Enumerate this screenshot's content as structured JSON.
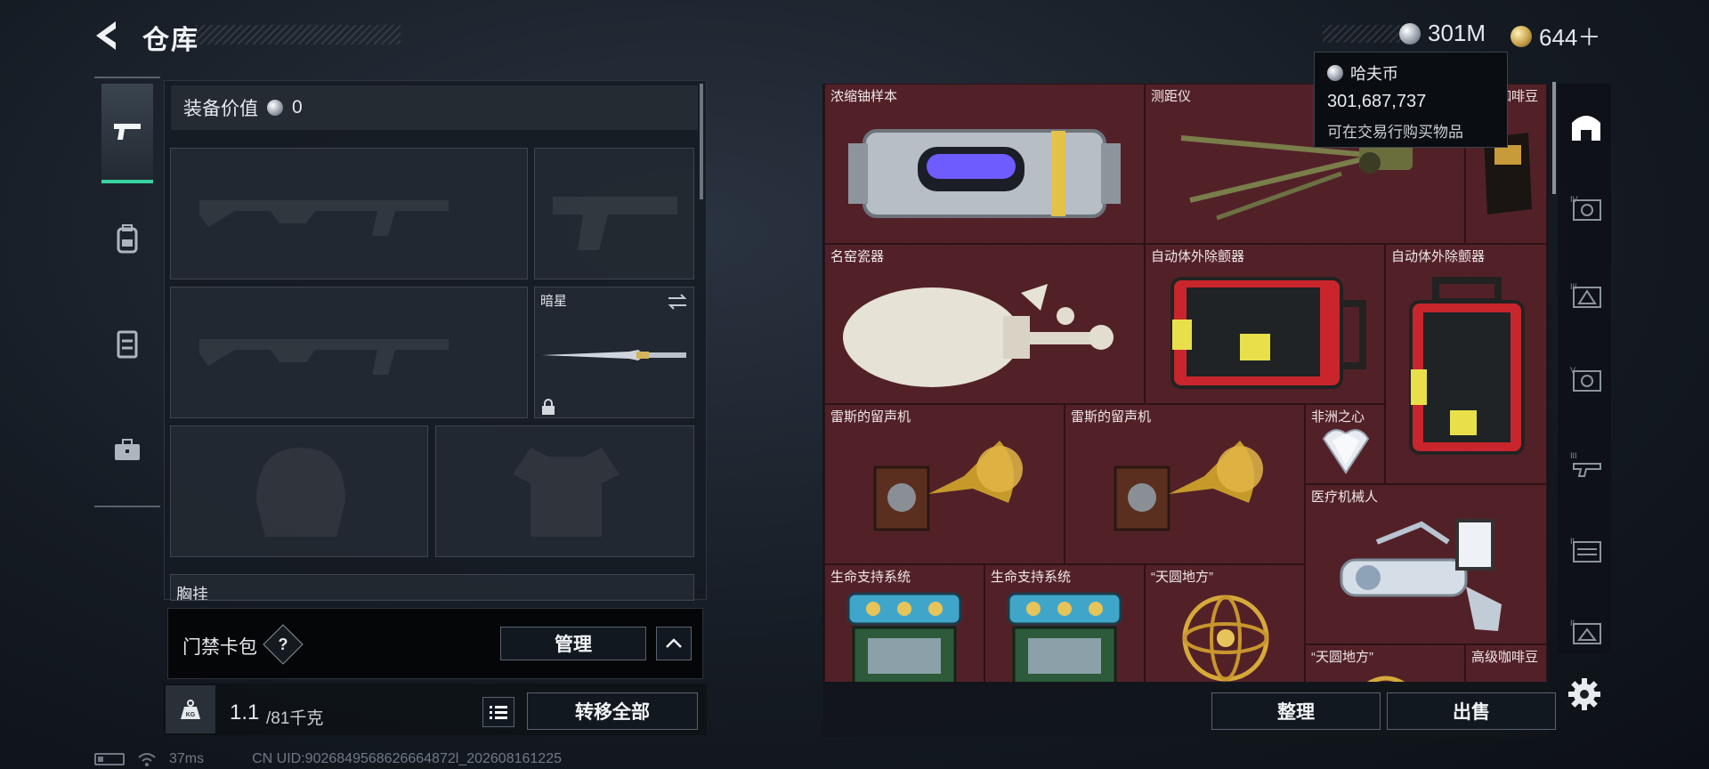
{
  "header": {
    "title": "仓库",
    "currency_haf": "301M",
    "currency_gold": "644＋"
  },
  "tooltip": {
    "name": "哈夫币",
    "amount": "301,687,737",
    "desc": "可在交易行购买物品"
  },
  "loadout": {
    "value_label": "装备价值",
    "value": "0",
    "melee_name": "暗星",
    "chest_label": "胸挂"
  },
  "cardpack": {
    "label": "门禁卡包",
    "help": "?",
    "manage": "管理"
  },
  "weight": {
    "icon": "KG",
    "current": "1.1",
    "max": "/81千克"
  },
  "actions": {
    "transfer_all": "转移全部",
    "sort": "整理",
    "sell": "出售"
  },
  "items": [
    {
      "name": "浓缩铀样本"
    },
    {
      "name": "测距仪"
    },
    {
      "name": "高级咖啡豆"
    },
    {
      "name": "名窑瓷器"
    },
    {
      "name": "自动体外除颤器"
    },
    {
      "name": "自动体外除颤器"
    },
    {
      "name": "雷斯的留声机"
    },
    {
      "name": "雷斯的留声机"
    },
    {
      "name": "非洲之心"
    },
    {
      "name": "医疗机械人"
    },
    {
      "name": "生命支持系统"
    },
    {
      "name": "生命支持系统"
    },
    {
      "name": "“天圆地方”"
    },
    {
      "name": "“天圆地方”"
    },
    {
      "name": "高级咖啡豆"
    }
  ],
  "status": {
    "ping": "37ms",
    "uid": "CN UID:9026849568626664872l_202608161225"
  },
  "colors": {
    "accent": "#38d3a0",
    "grid_bg": "#4a1f25",
    "item_bg": "#52222a"
  }
}
